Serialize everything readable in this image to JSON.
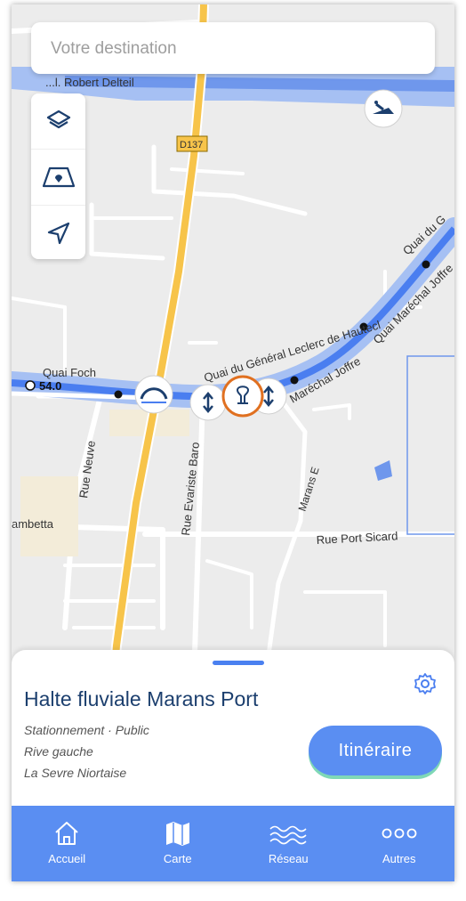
{
  "search": {
    "placeholder": "Votre destination"
  },
  "map_controls": [
    {
      "icon": "layers-icon"
    },
    {
      "icon": "map-view-icon"
    },
    {
      "icon": "locate-arrow-icon"
    }
  ],
  "map": {
    "streets": {
      "robert_delteil": "...l. Robert Delteil",
      "d137": "D137",
      "quai_foch": "Quai Foch",
      "quai_leclerc": "Quai du Général Leclerc de Hautecl",
      "quai_du": "Quai du G",
      "marechal_joffre": "Maréchal Joffre",
      "quai_marechal_joffre": "Quai Maréchal Joffre",
      "rue_neuve": "Rue Neuve",
      "rue_evariste": "Rue Evariste Baro",
      "marans_e": "Marans E",
      "gambetta": "ambetta",
      "rue_port_sicard": "Rue Port Sicard"
    },
    "km_marker": "54.0",
    "colors": {
      "river": "#6f97ec",
      "road": "#f7c44a",
      "selected": "#e07020"
    }
  },
  "place": {
    "name": "Halte fluviale Marans Port",
    "details": [
      "Stationnement · Public",
      "Rive gauche",
      "La Sevre Niortaise"
    ]
  },
  "route_button": {
    "label": "Itinéraire"
  },
  "nav": [
    {
      "label": "Accueil",
      "icon": "home-icon"
    },
    {
      "label": "Carte",
      "icon": "map-icon"
    },
    {
      "label": "Réseau",
      "icon": "waves-icon"
    },
    {
      "label": "Autres",
      "icon": "more-dots-icon"
    }
  ],
  "colors": {
    "accent": "#5a8ef2",
    "title": "#1c3f6e"
  }
}
